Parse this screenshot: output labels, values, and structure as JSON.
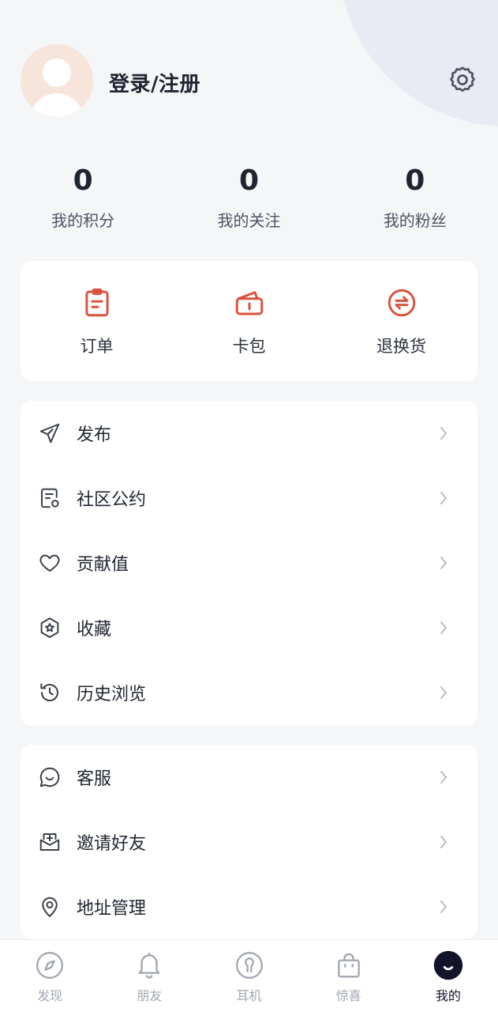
{
  "header": {
    "login_label": "登录/注册"
  },
  "stats": [
    {
      "value": "0",
      "label": "我的积分"
    },
    {
      "value": "0",
      "label": "我的关注"
    },
    {
      "value": "0",
      "label": "我的粉丝"
    }
  ],
  "shortcuts": [
    {
      "label": "订单",
      "icon": "clipboard-icon"
    },
    {
      "label": "卡包",
      "icon": "wallet-icon"
    },
    {
      "label": "退换货",
      "icon": "exchange-icon"
    }
  ],
  "menu_main": [
    {
      "label": "发布",
      "icon": "send-icon"
    },
    {
      "label": "社区公约",
      "icon": "document-icon"
    },
    {
      "label": "贡献值",
      "icon": "heart-icon"
    },
    {
      "label": "收藏",
      "icon": "star-hexagon-icon"
    },
    {
      "label": "历史浏览",
      "icon": "history-icon"
    }
  ],
  "menu_service": [
    {
      "label": "客服",
      "icon": "chat-icon"
    },
    {
      "label": "邀请好友",
      "icon": "invite-icon"
    },
    {
      "label": "地址管理",
      "icon": "location-icon"
    }
  ],
  "tabbar": [
    {
      "label": "发现",
      "icon": "compass-icon",
      "active": false
    },
    {
      "label": "朋友",
      "icon": "bell-icon",
      "active": false
    },
    {
      "label": "耳机",
      "icon": "earphone-icon",
      "active": false
    },
    {
      "label": "惊喜",
      "icon": "bag-icon",
      "active": false
    },
    {
      "label": "我的",
      "icon": "smile-icon",
      "active": true
    }
  ],
  "colors": {
    "accent": "#d9533f",
    "text_primary": "#1e2430",
    "icon_gray": "#3a404a",
    "tab_inactive": "#a3a8b1",
    "tab_active": "#12142a",
    "avatar_bg": "#f7e4da"
  }
}
